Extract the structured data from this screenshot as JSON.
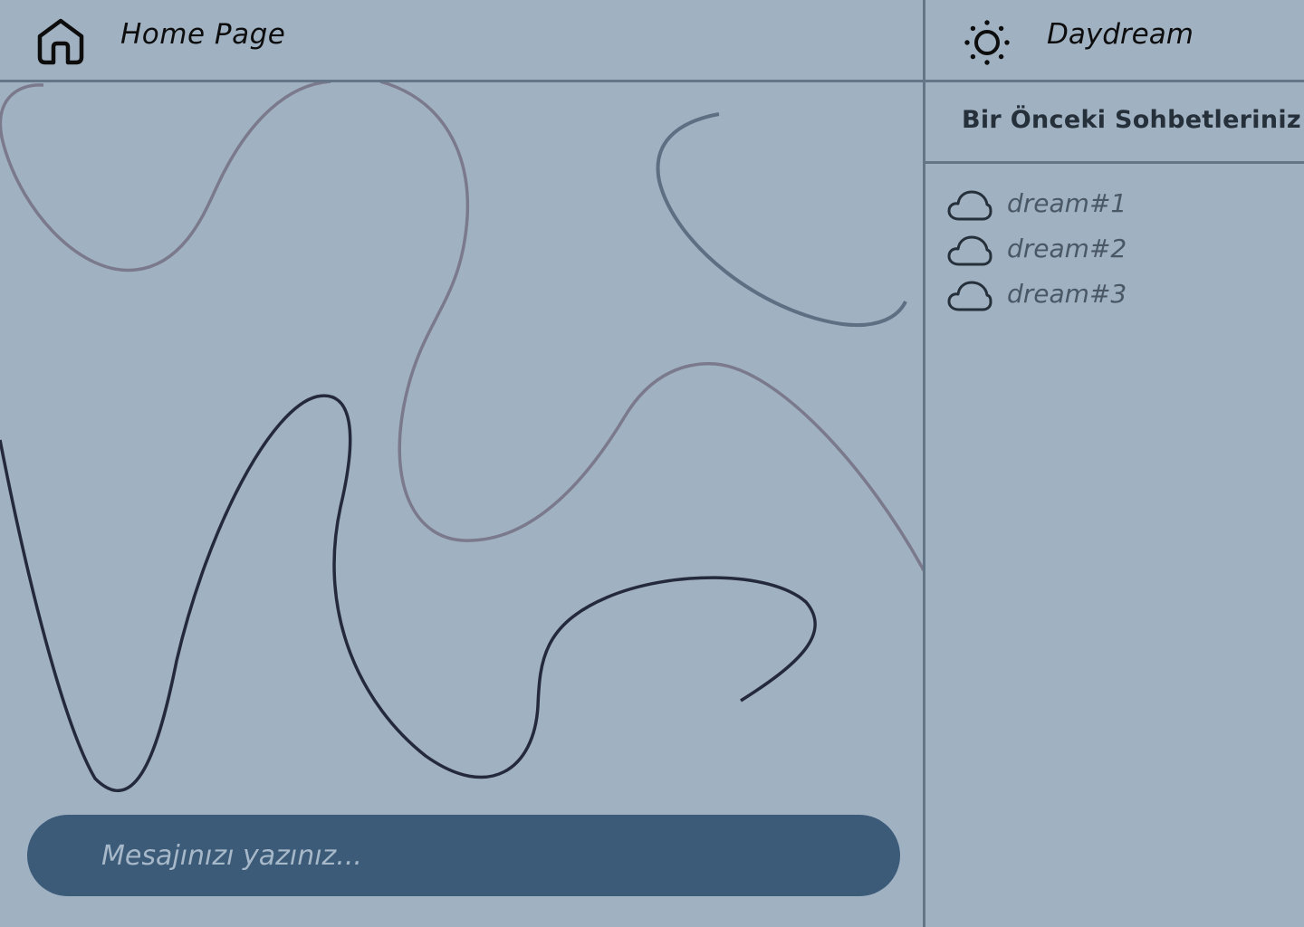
{
  "header": {
    "home_icon": "home-icon",
    "title": "Home Page"
  },
  "sidebar": {
    "theme_icon": "sun-icon",
    "brand": "Daydream",
    "section_title": "Bir Önceki Sohbetleriniz",
    "items": [
      {
        "icon": "cloud-icon",
        "label": "dream#1"
      },
      {
        "icon": "cloud-icon",
        "label": "dream#2"
      },
      {
        "icon": "cloud-icon",
        "label": "dream#3"
      }
    ]
  },
  "composer": {
    "value": "",
    "placeholder": "Mesajınızı yazınız..."
  },
  "colors": {
    "background": "#a0b1c2",
    "divider": "#647587",
    "composer": "#3b5b79",
    "curve_light": "#7b7a8c",
    "curve_mid": "#5f6f83",
    "curve_dark": "#242a3b"
  }
}
